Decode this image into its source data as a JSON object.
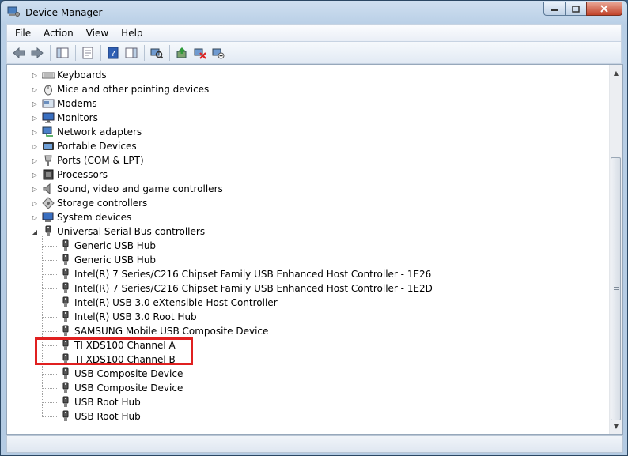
{
  "window": {
    "title": "Device Manager"
  },
  "menu": [
    "File",
    "Action",
    "View",
    "Help"
  ],
  "icons": {
    "toolbar": [
      "back-arrow-icon",
      "forward-arrow-icon",
      "show-hide-tree-icon",
      "properties-icon",
      "help-icon",
      "show-hide-action-pane-icon",
      "scan-hardware-changes-icon",
      "update-driver-icon",
      "uninstall-icon",
      "disable-device-icon"
    ]
  },
  "tree": {
    "categories": [
      {
        "label": "Keyboards",
        "icon": "keyboard-icon"
      },
      {
        "label": "Mice and other pointing devices",
        "icon": "mouse-icon"
      },
      {
        "label": "Modems",
        "icon": "modem-icon"
      },
      {
        "label": "Monitors",
        "icon": "monitor-icon"
      },
      {
        "label": "Network adapters",
        "icon": "network-adapter-icon"
      },
      {
        "label": "Portable Devices",
        "icon": "portable-device-icon"
      },
      {
        "label": "Ports (COM & LPT)",
        "icon": "port-icon"
      },
      {
        "label": "Processors",
        "icon": "processor-icon"
      },
      {
        "label": "Sound, video and game controllers",
        "icon": "speaker-icon"
      },
      {
        "label": "Storage controllers",
        "icon": "storage-icon"
      },
      {
        "label": "System devices",
        "icon": "system-device-icon"
      },
      {
        "label": "Universal Serial Bus controllers",
        "icon": "usb-plug-icon"
      }
    ],
    "usb_children": [
      "Generic USB Hub",
      "Generic USB Hub",
      "Intel(R) 7 Series/C216 Chipset Family USB Enhanced Host Controller - 1E26",
      "Intel(R) 7 Series/C216 Chipset Family USB Enhanced Host Controller - 1E2D",
      "Intel(R) USB 3.0 eXtensible Host Controller",
      "Intel(R) USB 3.0 Root Hub",
      "SAMSUNG Mobile USB Composite Device",
      "TI XDS100 Channel A",
      "TI XDS100 Channel B",
      "USB Composite Device",
      "USB Composite Device",
      "USB Root Hub",
      "USB Root Hub"
    ]
  },
  "colors": {
    "highlight_box": "#e02020",
    "window_frame": "#b9cfe6"
  }
}
